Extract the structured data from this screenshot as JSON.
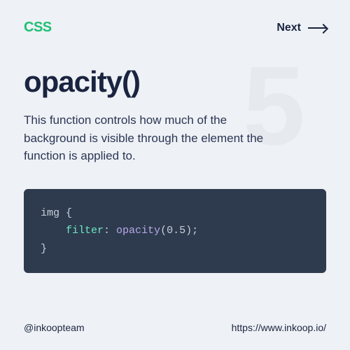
{
  "header": {
    "brand": "CSS",
    "next_label": "Next"
  },
  "watermark": "5",
  "content": {
    "title": "opacity()",
    "description": "This function controls how much of the background is visible through the element the function is applied to."
  },
  "code": {
    "selector": "img",
    "open_brace": " {",
    "indent": "    ",
    "property": "filter",
    "colon": ": ",
    "func": "opacity",
    "lparen": "(",
    "value": "0.5",
    "rparen": ")",
    "semi": ";",
    "close_brace": "}"
  },
  "footer": {
    "handle": "@inkoopteam",
    "url": "https://www.inkoop.io/"
  }
}
